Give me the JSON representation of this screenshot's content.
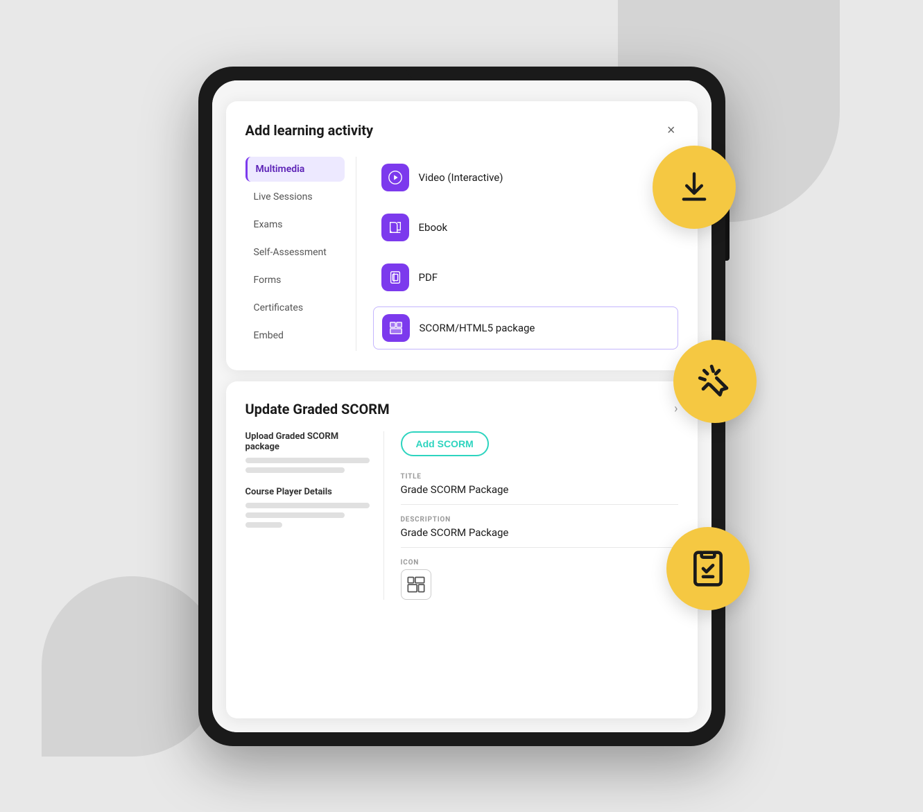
{
  "background": {
    "color": "#e8e8e8"
  },
  "modal": {
    "title": "Add learning activity",
    "close_label": "×",
    "nav_items": [
      {
        "label": "Multimedia",
        "active": true
      },
      {
        "label": "Live Sessions",
        "active": false
      },
      {
        "label": "Exams",
        "active": false
      },
      {
        "label": "Self-Assessment",
        "active": false
      },
      {
        "label": "Forms",
        "active": false
      },
      {
        "label": "Certificates",
        "active": false
      },
      {
        "label": "Embed",
        "active": false
      }
    ],
    "activities": [
      {
        "label": "Video (Interactive)",
        "icon": "video-icon"
      },
      {
        "label": "Ebook",
        "icon": "book-icon"
      },
      {
        "label": "PDF",
        "icon": "pdf-icon"
      },
      {
        "label": "SCORM/HTML5 package",
        "icon": "scorm-icon",
        "selected": true
      }
    ]
  },
  "scorm_panel": {
    "title": "Update Graded SCORM",
    "left_sections": [
      {
        "label": "Upload Graded SCORM package"
      },
      {
        "label": "Course Player Details"
      }
    ],
    "upload_button": "Add SCORM",
    "fields": [
      {
        "label": "TITLE",
        "value": "Grade SCORM Package"
      },
      {
        "label": "DESCRIPTION",
        "value": "Grade SCORM Package"
      },
      {
        "label": "ICON",
        "value": ""
      }
    ]
  },
  "floating_circles": [
    {
      "name": "download",
      "icon": "download-icon"
    },
    {
      "name": "click",
      "icon": "cursor-click-icon"
    },
    {
      "name": "clipboard",
      "icon": "clipboard-check-icon"
    }
  ]
}
